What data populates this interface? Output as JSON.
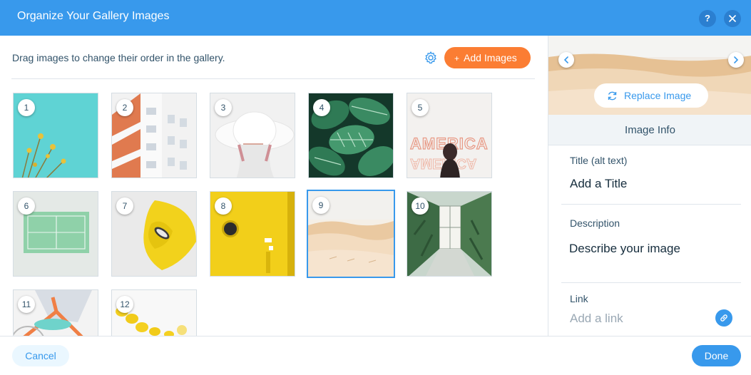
{
  "header": {
    "title": "Organize Your Gallery Images",
    "help_label": "?",
    "help_icon": "question-icon",
    "close_icon": "close-icon"
  },
  "toolbar": {
    "instructions": "Drag images to change their order in the gallery.",
    "settings_icon": "gear-icon",
    "add_images_plus": "+",
    "add_images_label": "Add Images"
  },
  "gallery": {
    "selected_index": 9,
    "items": [
      {
        "number": "1",
        "subject": "yellow flowers against turquoise sky"
      },
      {
        "number": "2",
        "subject": "white building facade with orange accents"
      },
      {
        "number": "3",
        "subject": "woman in white hat"
      },
      {
        "number": "4",
        "subject": "green striped leaves"
      },
      {
        "number": "5",
        "subject": "AMERICA neon sign with person"
      },
      {
        "number": "6",
        "subject": "green tennis court aerial view"
      },
      {
        "number": "7",
        "subject": "yellow chair on grey floor"
      },
      {
        "number": "8",
        "subject": "yellow door with porthole"
      },
      {
        "number": "9",
        "subject": "desert sand dunes"
      },
      {
        "number": "10",
        "subject": "greenhouse corridor with plants"
      },
      {
        "number": "11",
        "subject": "person on orange bicycle"
      },
      {
        "number": "12",
        "subject": "lemons on white surface"
      }
    ]
  },
  "panel": {
    "replace_label": "Replace Image",
    "section_title": "Image Info",
    "title_label": "Title (alt text)",
    "title_value": "Add a Title",
    "description_label": "Description",
    "description_value": "Describe your image",
    "link_label": "Link",
    "link_placeholder": "Add a link",
    "link_icon": "link-icon",
    "prev_icon": "chevron-left-icon",
    "next_icon": "chevron-right-icon",
    "replace_icon": "refresh-icon"
  },
  "footer": {
    "cancel_label": "Cancel",
    "done_label": "Done"
  },
  "colors": {
    "header_blue": "#3899ec",
    "accent_orange": "#fb7d33",
    "text_dark": "#32536a",
    "panel_bg": "#f0f4f7"
  }
}
